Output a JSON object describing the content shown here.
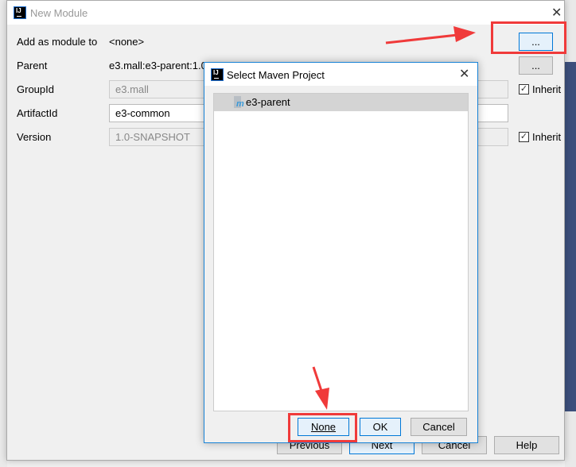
{
  "window": {
    "title": "New Module",
    "close_icon": "close-icon"
  },
  "form": {
    "add_as_module_label": "Add as module to",
    "add_as_module_value": "<none>",
    "parent_label": "Parent",
    "parent_value": "e3.mall:e3-parent:1.0-SNAPSHOT",
    "groupid_label": "GroupId",
    "groupid_value": "e3.mall",
    "artifactid_label": "ArtifactId",
    "artifactid_value": "e3-common",
    "version_label": "Version",
    "version_value": "1.0-SNAPSHOT",
    "browse_label": "...",
    "inherit_label": "Inherit"
  },
  "footer": {
    "previous": "Previous",
    "next": "Next",
    "cancel": "Cancel",
    "help": "Help"
  },
  "dialog": {
    "title": "Select Maven Project",
    "items": [
      {
        "label": "e3-parent",
        "icon": "maven-module-icon",
        "selected": true
      }
    ],
    "none": "None",
    "ok": "OK",
    "cancel": "Cancel"
  },
  "annotations": {
    "color": "#f03a3a"
  }
}
